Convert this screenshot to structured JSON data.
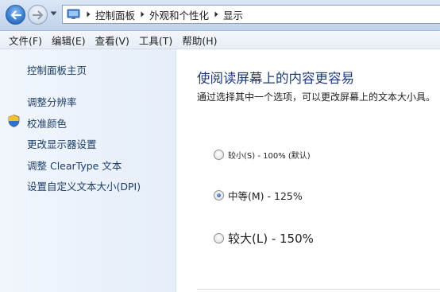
{
  "address_bar": {
    "back_button": "back-arrow-icon",
    "forward_button": "forward-arrow-icon",
    "location_icon": "control-panel-icon",
    "breadcrumbs": [
      "控制面板",
      "外观和个性化",
      "显示"
    ]
  },
  "menu": {
    "items": [
      "文件(F)",
      "编辑(E)",
      "查看(V)",
      "工具(T)",
      "帮助(H)"
    ]
  },
  "sidebar": {
    "home_link": "控制面板主页",
    "links": [
      "调整分辨率",
      "校准颜色",
      "更改显示器设置",
      "调整 ClearType 文本",
      "设置自定义文本大小(DPI)"
    ],
    "shield_icon": "uac-shield-icon"
  },
  "main": {
    "title": "使阅读屏幕上的内容更容易",
    "description": "通过选择其中一个选项，可以更改屏幕上的文本大小具。",
    "options": [
      {
        "label": "较小(S) - 100% (默认)",
        "selected": false
      },
      {
        "label": "中等(M) - 125%",
        "selected": true
      },
      {
        "label": "较大(L) - 150%",
        "selected": false
      }
    ]
  },
  "colors": {
    "title": "#1e3a78",
    "sidebar_link": "#1c3d66",
    "sidebar_bg": "#e6eef9",
    "accent": "#2a5fa8"
  }
}
